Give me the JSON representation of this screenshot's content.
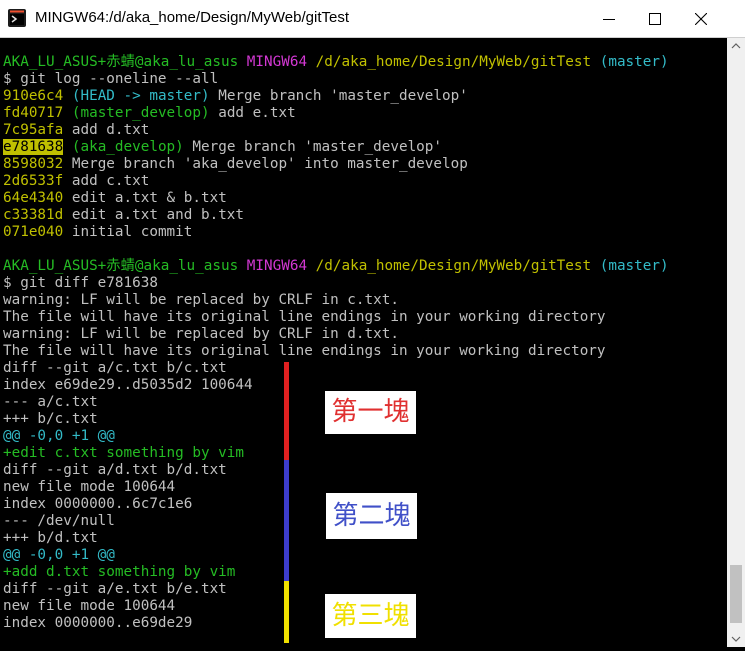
{
  "window": {
    "title": "MINGW64:/d/aka_home/Design/MyWeb/gitTest",
    "icon": "git-bash-icon",
    "controls": [
      "minimize-icon",
      "maximize-icon",
      "close-icon"
    ]
  },
  "terminal": {
    "prompt1": {
      "user": "AKA_LU_ASUS+赤蜻@aka_lu_asus",
      "env": "MINGW64",
      "path": "/d/aka_home/Design/MyWeb/gitTest",
      "branch": "(master)"
    },
    "cmd1": "$ git log --oneline --all",
    "log": [
      {
        "hash": "910e6c4",
        "refs": "(HEAD -> master)",
        "msg": " Merge branch 'master_develop'"
      },
      {
        "hash": "fd40717",
        "refs": "(master_develop)",
        "msg": " add e.txt"
      },
      {
        "hash": "7c95afa",
        "refs": "",
        "msg": " add d.txt"
      },
      {
        "hash": "e781638",
        "refs": "(aka_develop)",
        "msg": " Merge branch 'master_develop'"
      },
      {
        "hash": "8598032",
        "refs": "",
        "msg": " Merge branch 'aka_develop' into master_develop"
      },
      {
        "hash": "2d6533f",
        "refs": "",
        "msg": " add c.txt"
      },
      {
        "hash": "64e4340",
        "refs": "",
        "msg": " edit a.txt & b.txt"
      },
      {
        "hash": "c33381d",
        "refs": "",
        "msg": " edit a.txt and b.txt"
      },
      {
        "hash": "071e040",
        "refs": "",
        "msg": " initial commit"
      }
    ],
    "prompt2": {
      "user": "AKA_LU_ASUS+赤蜻@aka_lu_asus",
      "env": "MINGW64",
      "path": "/d/aka_home/Design/MyWeb/gitTest",
      "branch": "(master)"
    },
    "cmd2": "$ git diff e781638",
    "warn1": "warning: LF will be replaced by CRLF in c.txt.",
    "note1": "The file will have its original line endings in your working directory",
    "warn2": "warning: LF will be replaced by CRLF in d.txt.",
    "note2": "The file will have its original line endings in your working directory",
    "diff": [
      {
        "text": "diff --git a/c.txt b/c.txt",
        "color": "w"
      },
      {
        "text": "index e69de29..d5035d2 100644",
        "color": "w"
      },
      {
        "text": "--- a/c.txt",
        "color": "w"
      },
      {
        "text": "+++ b/c.txt",
        "color": "w"
      },
      {
        "text": "@@ -0,0 +1 @@",
        "color": "c"
      },
      {
        "text": "+edit c.txt something by vim",
        "color": "g"
      },
      {
        "text": "diff --git a/d.txt b/d.txt",
        "color": "w"
      },
      {
        "text": "new file mode 100644",
        "color": "w"
      },
      {
        "text": "index 0000000..6c7c1e6",
        "color": "w"
      },
      {
        "text": "--- /dev/null",
        "color": "w"
      },
      {
        "text": "+++ b/d.txt",
        "color": "w"
      },
      {
        "text": "@@ -0,0 +1 @@",
        "color": "c"
      },
      {
        "text": "+add d.txt something by vim",
        "color": "g"
      },
      {
        "text": "diff --git a/e.txt b/e.txt",
        "color": "w"
      },
      {
        "text": "new file mode 100644",
        "color": "w"
      },
      {
        "text": "index 0000000..e69de29",
        "color": "w"
      }
    ]
  },
  "annotations": {
    "label1": "第一塊",
    "label2": "第二塊",
    "label3": "第三塊",
    "colors": {
      "red": "#e02020",
      "blue": "#3c3ccc",
      "yellow": "#f0e000"
    }
  }
}
